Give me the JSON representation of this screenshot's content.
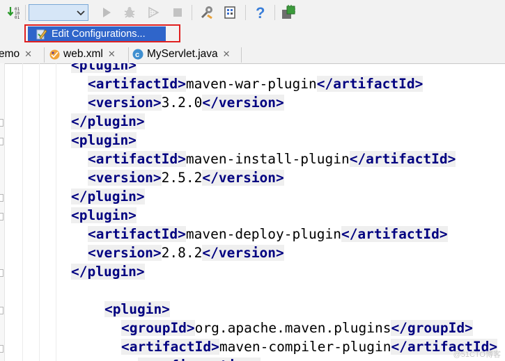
{
  "toolbar": {
    "buttons": [
      {
        "name": "make-project-icon"
      },
      {
        "name": "run-icon"
      },
      {
        "name": "debug-icon"
      },
      {
        "name": "coverage-icon"
      },
      {
        "name": "stop-icon"
      },
      {
        "name": "settings-icon"
      },
      {
        "name": "project-structure-icon"
      },
      {
        "name": "help-icon"
      },
      {
        "name": "plugin-icon"
      }
    ],
    "run_config_value": ""
  },
  "dropdown": {
    "edit_configurations_label": "Edit Configurations..."
  },
  "tabs": [
    {
      "label": "emo",
      "icon": null
    },
    {
      "label": "web.xml",
      "icon": "xml-file-icon"
    },
    {
      "label": "MyServlet.java",
      "icon": "java-class-icon"
    }
  ],
  "code": {
    "lines": [
      {
        "indent": 0,
        "parts": [
          {
            "t": "tag",
            "v": "<plugin>"
          }
        ]
      },
      {
        "indent": 1,
        "parts": [
          {
            "t": "tag",
            "v": "<artifactId>"
          },
          {
            "t": "text",
            "v": "maven-war-plugin"
          },
          {
            "t": "tag",
            "v": "</artifactId>"
          }
        ]
      },
      {
        "indent": 1,
        "parts": [
          {
            "t": "tag",
            "v": "<version>"
          },
          {
            "t": "text",
            "v": "3.2.0"
          },
          {
            "t": "tag",
            "v": "</version>"
          }
        ]
      },
      {
        "indent": 0,
        "parts": [
          {
            "t": "tag",
            "v": "</plugin>"
          }
        ]
      },
      {
        "indent": 0,
        "parts": [
          {
            "t": "tag",
            "v": "<plugin>"
          }
        ]
      },
      {
        "indent": 1,
        "parts": [
          {
            "t": "tag",
            "v": "<artifactId>"
          },
          {
            "t": "text",
            "v": "maven-install-plugin"
          },
          {
            "t": "tag",
            "v": "</artifactId>"
          }
        ]
      },
      {
        "indent": 1,
        "parts": [
          {
            "t": "tag",
            "v": "<version>"
          },
          {
            "t": "text",
            "v": "2.5.2"
          },
          {
            "t": "tag",
            "v": "</version>"
          }
        ]
      },
      {
        "indent": 0,
        "parts": [
          {
            "t": "tag",
            "v": "</plugin>"
          }
        ]
      },
      {
        "indent": 0,
        "parts": [
          {
            "t": "tag",
            "v": "<plugin>"
          }
        ]
      },
      {
        "indent": 1,
        "parts": [
          {
            "t": "tag",
            "v": "<artifactId>"
          },
          {
            "t": "text",
            "v": "maven-deploy-plugin"
          },
          {
            "t": "tag",
            "v": "</artifactId>"
          }
        ]
      },
      {
        "indent": 1,
        "parts": [
          {
            "t": "tag",
            "v": "<version>"
          },
          {
            "t": "text",
            "v": "2.8.2"
          },
          {
            "t": "tag",
            "v": "</version>"
          }
        ]
      },
      {
        "indent": 0,
        "parts": [
          {
            "t": "tag",
            "v": "</plugin>"
          }
        ]
      },
      {
        "indent": 0,
        "parts": []
      },
      {
        "indent": 2,
        "parts": [
          {
            "t": "tag",
            "v": "<plugin>"
          }
        ]
      },
      {
        "indent": 3,
        "parts": [
          {
            "t": "tag",
            "v": "<groupId>"
          },
          {
            "t": "text",
            "v": "org.apache.maven.plugins"
          },
          {
            "t": "tag",
            "v": "</groupId>"
          }
        ]
      },
      {
        "indent": 3,
        "parts": [
          {
            "t": "tag",
            "v": "<artifactId>"
          },
          {
            "t": "text",
            "v": "maven-compiler-plugin"
          },
          {
            "t": "tag",
            "v": "</artifactId>"
          }
        ]
      },
      {
        "indent": 4,
        "parts": [
          {
            "t": "tag",
            "v": "<configuration>"
          }
        ]
      }
    ]
  },
  "watermark": "@51CTO博客",
  "colors": {
    "tag": "#000080",
    "tag_bg": "#efefef",
    "selection": "#2f65ca",
    "highlight_box": "#e02020"
  }
}
